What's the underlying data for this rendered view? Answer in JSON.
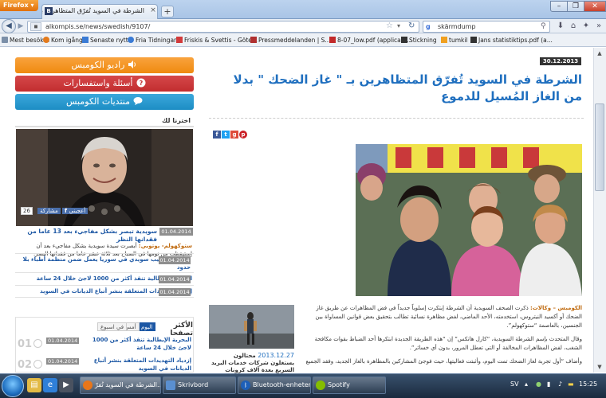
{
  "browser": {
    "app_button": "Firefox",
    "tab_title": "الشرطة في السويد تُفرّق المتظاهرين بـ ...",
    "tab_icon_letter": "B",
    "url": "alkompis.se/news/swedish/9107/",
    "search_value": "skärmdump",
    "bookmarks": [
      {
        "label": "Mest besökta",
        "color": "#7b8fa8"
      },
      {
        "label": "Kom igång",
        "color": "#e37a1c"
      },
      {
        "label": "Senaste nytt",
        "color": "#3a7bd5"
      },
      {
        "label": "Fria Tidningar",
        "color": "#3a7bd5"
      },
      {
        "label": "Friskis & Svettis - Göte...",
        "color": "#d23a3a"
      },
      {
        "label": "Pressmeddelanden | S...",
        "color": "#b03030"
      },
      {
        "label": "8-07_low.pdf (applicati...",
        "color": "#c22a2a"
      },
      {
        "label": "Stickning",
        "color": "#333333"
      },
      {
        "label": "tumkil",
        "color": "#f0a020"
      },
      {
        "label": "Jans statistiktips.pdf (a...",
        "color": "#333333"
      }
    ]
  },
  "sidebar": {
    "radio": "راديو الكومبس",
    "faq": "أسئلة واستفسارات",
    "forums": "منتديات الكومبس",
    "picked_heading": "اخترنا لك",
    "share_like": "أعجبني",
    "share_label": "مشاركة",
    "share_count": "26",
    "featured": {
      "title": "سويدية تبصر بشكل مفاجيء بعد 13 عاما من فقدانها النظر",
      "author": "ستوكهولم- يوتوبي:",
      "text": "أبصرت سيدة سويدية بشكل مفاجيء بعد أن إستيقظت من نومها في الصباح بعد ثلاثة عشر عاما من فقدانها البصر.",
      "date": "01.04.2014"
    },
    "picked_rows": [
      {
        "title": "إختطاف طبيب سويدي في سوريا يعمل ضمن منظمة أطباء بلا حدود",
        "date": "01.04.2014"
      },
      {
        "title": "البحرية الإيطالية تنقذ أكثر من 1000 لاجئ خلال 24 ساعة",
        "date": "01.04.2014"
      },
      {
        "title": "إزدياد التهديدات المتعلقة بنشر أتباع الديانات في السويد",
        "date": "01.04.2014"
      }
    ],
    "most_read": {
      "title": "الأكثر تصفحا",
      "tabs": [
        "اليوم",
        "أمس",
        "في اسبوع"
      ],
      "rows": [
        {
          "num": "01",
          "title": "البحرية الإيطالية تنقذ أكثر من 1000 لاجئ خلال 24 ساعة",
          "date": "01.04.2014"
        },
        {
          "num": "02",
          "title": "إزدياد التهديدات المتعلقة بنشر أتباع الديانات في السويد",
          "date": "01.04.2014"
        }
      ]
    }
  },
  "article": {
    "date": "30.12.2013",
    "title": "الشرطة في السويد تُفرّق المتظاهرين بـ \" غاز الضحك \" بدلا من الغاز المُسيل للدموع",
    "lead_source": "الكومبس – وكالات:",
    "lead_p1": "ذكرت الصحف السويدية أن الشرطة إبتكرت إسلوباً جديداً في فض المظاهرات عن طريق غاز الضحك أو أكسيد النيتروس، استخدمته، الأحد الماضي، لفض مظاهرة نسائية تطالب بتحقيق بعض قوانين المساواة بين الجنسين، بالعاصمة “ستوكهولم”.",
    "lead_p2": "وقال المتحدث بإسم الشرطة السويدية، “كارل هانكس” إن “هذه الطريقة الجديدة ابتكرها أحد الضباط بقوات مكافحة الشغب، لفض المظاهرات المخالفة أو التي تعطل المرور، بدون أي خسائر”.",
    "lead_p3": "وأضاف “أول تجربة لغاز الضحك تمت اليوم، وأثبتت فعاليتها، حيث فوجئ المشاركين بالمظاهرة بالغاز الجديد، وفقد الجميع"
  },
  "related": {
    "date": "2013.12.27",
    "title": "محتالون يستغلون شركات خدمات البريد السريع بعدة آلاف كرونات"
  },
  "taskbar": {
    "tasks": [
      "الشرطة في السويد تُفرّ...",
      "Skrivbord",
      "Bluetooth-enheter",
      "Spotify"
    ],
    "lang": "SV",
    "clock": "15:25"
  }
}
